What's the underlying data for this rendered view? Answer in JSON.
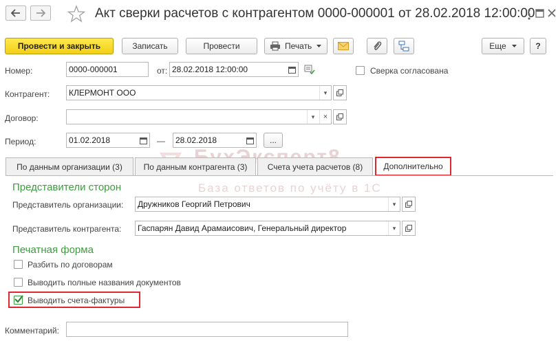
{
  "window": {
    "title": "Акт сверки расчетов с контрагентом 0000-000001 от 28.02.2018 12:00:00"
  },
  "icons": {
    "back": "arrow-left-icon",
    "forward": "arrow-right-icon",
    "favorite": "star-icon",
    "menu": "more-vertical-icon",
    "maximize": "maximize-icon",
    "close": "close-icon"
  },
  "toolbar": {
    "post_close": "Провести и закрыть",
    "write": "Записать",
    "post": "Провести",
    "print": "Печать",
    "more": "Еще",
    "help": "?"
  },
  "form": {
    "number_label": "Номер:",
    "number_value": "0000-000001",
    "date_label": "от:",
    "date_value": "28.02.2018 12:00:00",
    "agreed_label": "Сверка согласована",
    "counterparty_label": "Контрагент:",
    "counterparty_value": "КЛЕРМОНТ ООО",
    "contract_label": "Договор:",
    "contract_value": "",
    "period_label": "Период:",
    "period_from": "01.02.2018",
    "period_dash": "—",
    "period_to": "28.02.2018",
    "period_more": "..."
  },
  "tabs": [
    {
      "label": "По данным организации (3)",
      "active": false
    },
    {
      "label": "По данным контрагента (3)",
      "active": false
    },
    {
      "label": "Счета учета расчетов (8)",
      "active": false
    },
    {
      "label": "Дополнительно",
      "active": true
    }
  ],
  "extra": {
    "representatives_title": "Представители сторон",
    "org_rep_label": "Представитель организации:",
    "org_rep_value": "Дружников Георгий Петрович",
    "cp_rep_label": "Представитель контрагента:",
    "cp_rep_value": "Гаспарян Давид Арамаисович, Генеральный директор",
    "print_form_title": "Печатная форма",
    "split_contracts_label": "Разбить по договорам",
    "split_contracts_checked": false,
    "full_names_label": "Выводить полные названия документов",
    "full_names_checked": false,
    "invoices_label": "Выводить счета-фактуры",
    "invoices_checked": true
  },
  "comment_label": "Комментарий:",
  "comment_value": "",
  "watermark": {
    "brand": "БухЭксперт8",
    "tagline": "База ответов по учёту в 1С"
  },
  "colors": {
    "accent_yellow": "#f3cf16",
    "section_green": "#3d9c3f",
    "highlight_red": "#e0262e"
  }
}
